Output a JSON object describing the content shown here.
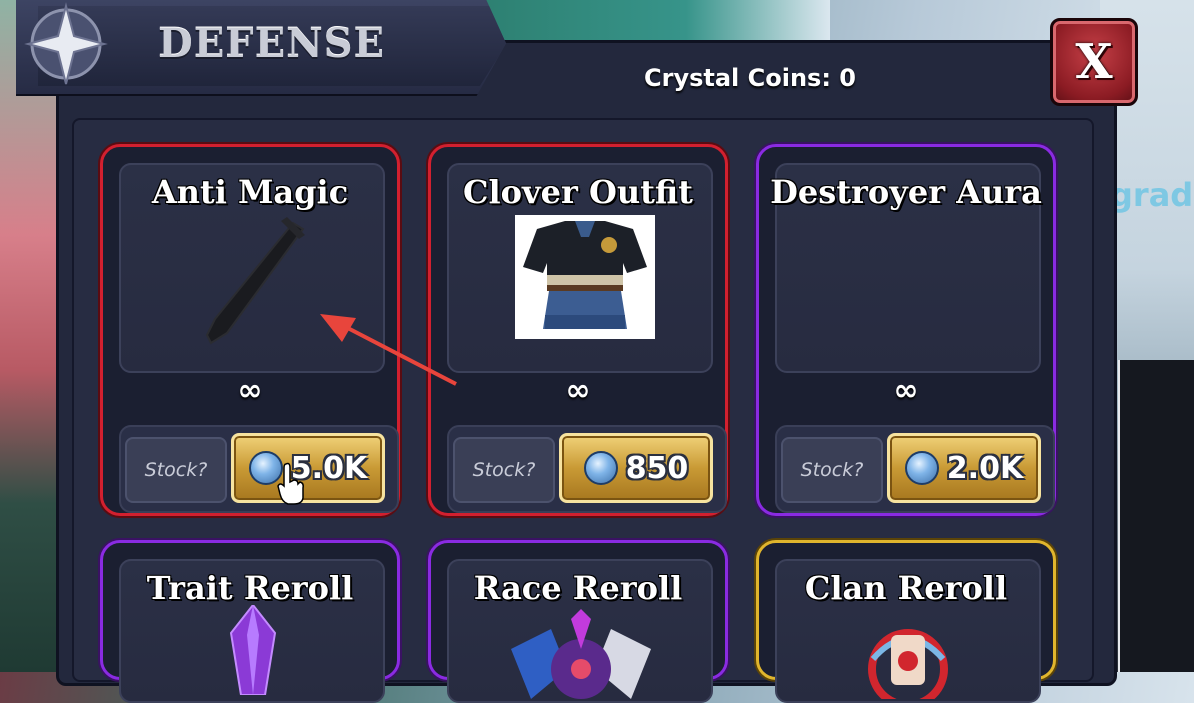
{
  "window": {
    "title": "DEFENSE",
    "currency_label": "Crystal Coins: 0",
    "close_label": "X"
  },
  "background": {
    "partial_text": "grade"
  },
  "shop_items": [
    {
      "name": "Anti Magic",
      "stock": "∞",
      "stock_label": "Stock?",
      "price": "5.0K",
      "rarity_color": "#d2202f",
      "icon": "sword-icon"
    },
    {
      "name": "Clover Outfit",
      "stock": "∞",
      "stock_label": "Stock?",
      "price": "850",
      "rarity_color": "#d2202f",
      "icon": "outfit-image"
    },
    {
      "name": "Destroyer Aura",
      "stock": "∞",
      "stock_label": "Stock?",
      "price": "2.0K",
      "rarity_color": "#8a2be2",
      "icon": "aura-icon"
    },
    {
      "name": "Trait Reroll",
      "rarity_color": "#8a2be2",
      "icon": "crystal-icon"
    },
    {
      "name": "Race Reroll",
      "rarity_color": "#8a2be2",
      "icon": "winged-helmet-icon"
    },
    {
      "name": "Clan Reroll",
      "rarity_color": "#e0b52d",
      "icon": "clan-emblem-icon"
    }
  ],
  "colors": {
    "red_rarity": "#d2202f",
    "purple_rarity": "#8a2be2",
    "gold_rarity": "#e0b52d",
    "price_button": "#c99a35"
  }
}
